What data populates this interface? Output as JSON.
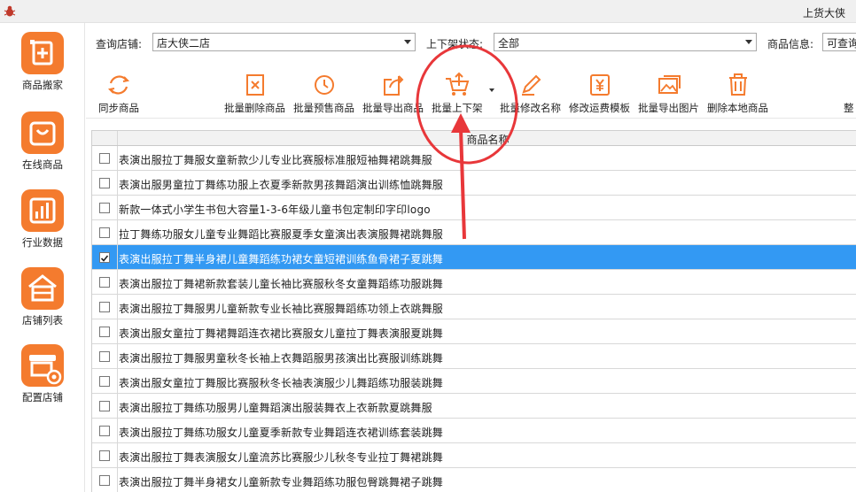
{
  "window": {
    "title": "上货大侠"
  },
  "sidebar": {
    "items": [
      {
        "label": "商品搬家",
        "icon": "add-product-icon"
      },
      {
        "label": "在线商品",
        "icon": "shopping-bag-icon"
      },
      {
        "label": "行业数据",
        "icon": "bar-chart-icon"
      },
      {
        "label": "店铺列表",
        "icon": "store-icon"
      },
      {
        "label": "配置店铺",
        "icon": "store-settings-icon"
      }
    ]
  },
  "filters": {
    "shop_label": "查询店铺:",
    "shop_value": "店大侠二店",
    "status_label": "上下架状态:",
    "status_value": "全部",
    "info_label": "商品信息:",
    "info_value": "可查询"
  },
  "toolbar": {
    "sync": "同步商品",
    "batch_delete": "批量删除商品",
    "batch_presale": "批量预售商品",
    "batch_export": "批量导出商品",
    "batch_shelf": "批量上下架",
    "batch_rename": "批量修改名称",
    "edit_freight": "修改运费模板",
    "export_images": "批量导出图片",
    "delete_local": "删除本地商品",
    "more": "整"
  },
  "table": {
    "header": "商品名称",
    "selected_index": 4,
    "rows": [
      {
        "name": "表演出服拉丁舞服女童新款少儿专业比赛服标准服短袖舞裙跳舞服",
        "checked": false
      },
      {
        "name": "表演出服男童拉丁舞练功服上衣夏季新款男孩舞蹈演出训练恤跳舞服",
        "checked": false
      },
      {
        "name": "新款一体式小学生书包大容量1-3-6年级儿童书包定制印字印logo",
        "checked": false
      },
      {
        "name": "拉丁舞练功服女儿童专业舞蹈比赛服夏季女童演出表演服舞裙跳舞服",
        "checked": false
      },
      {
        "name": "表演出服拉丁舞半身裙儿童舞蹈练功裙女童短裙训练鱼骨裙子夏跳舞",
        "checked": true
      },
      {
        "name": "表演出服拉丁舞裙新款套装儿童长袖比赛服秋冬女童舞蹈练功服跳舞",
        "checked": false
      },
      {
        "name": "表演出服拉丁舞服男儿童新款专业长袖比赛服舞蹈练功领上衣跳舞服",
        "checked": false
      },
      {
        "name": "表演出服女童拉丁舞裙舞蹈连衣裙比赛服女儿童拉丁舞表演服夏跳舞",
        "checked": false
      },
      {
        "name": "表演出服拉丁舞服男童秋冬长袖上衣舞蹈服男孩演出比赛服训练跳舞",
        "checked": false
      },
      {
        "name": "表演出服女童拉丁舞服比赛服秋冬长袖表演服少儿舞蹈练功服装跳舞",
        "checked": false
      },
      {
        "name": "表演出服拉丁舞练功服男儿童舞蹈演出服装舞衣上衣新款夏跳舞服",
        "checked": false
      },
      {
        "name": "表演出服拉丁舞练功服女儿童夏季新款专业舞蹈连衣裙训练套装跳舞",
        "checked": false
      },
      {
        "name": "表演出服拉丁舞表演服女儿童流苏比赛服少儿秋冬专业拉丁舞裙跳舞",
        "checked": false
      },
      {
        "name": "表演出服拉丁舞半身裙女儿童新款专业舞蹈练功服包臀跳舞裙子跳舞",
        "checked": false
      }
    ]
  },
  "colors": {
    "accent": "#f47b2e",
    "selected_row": "#3399f3",
    "annotation": "#e8373a"
  }
}
